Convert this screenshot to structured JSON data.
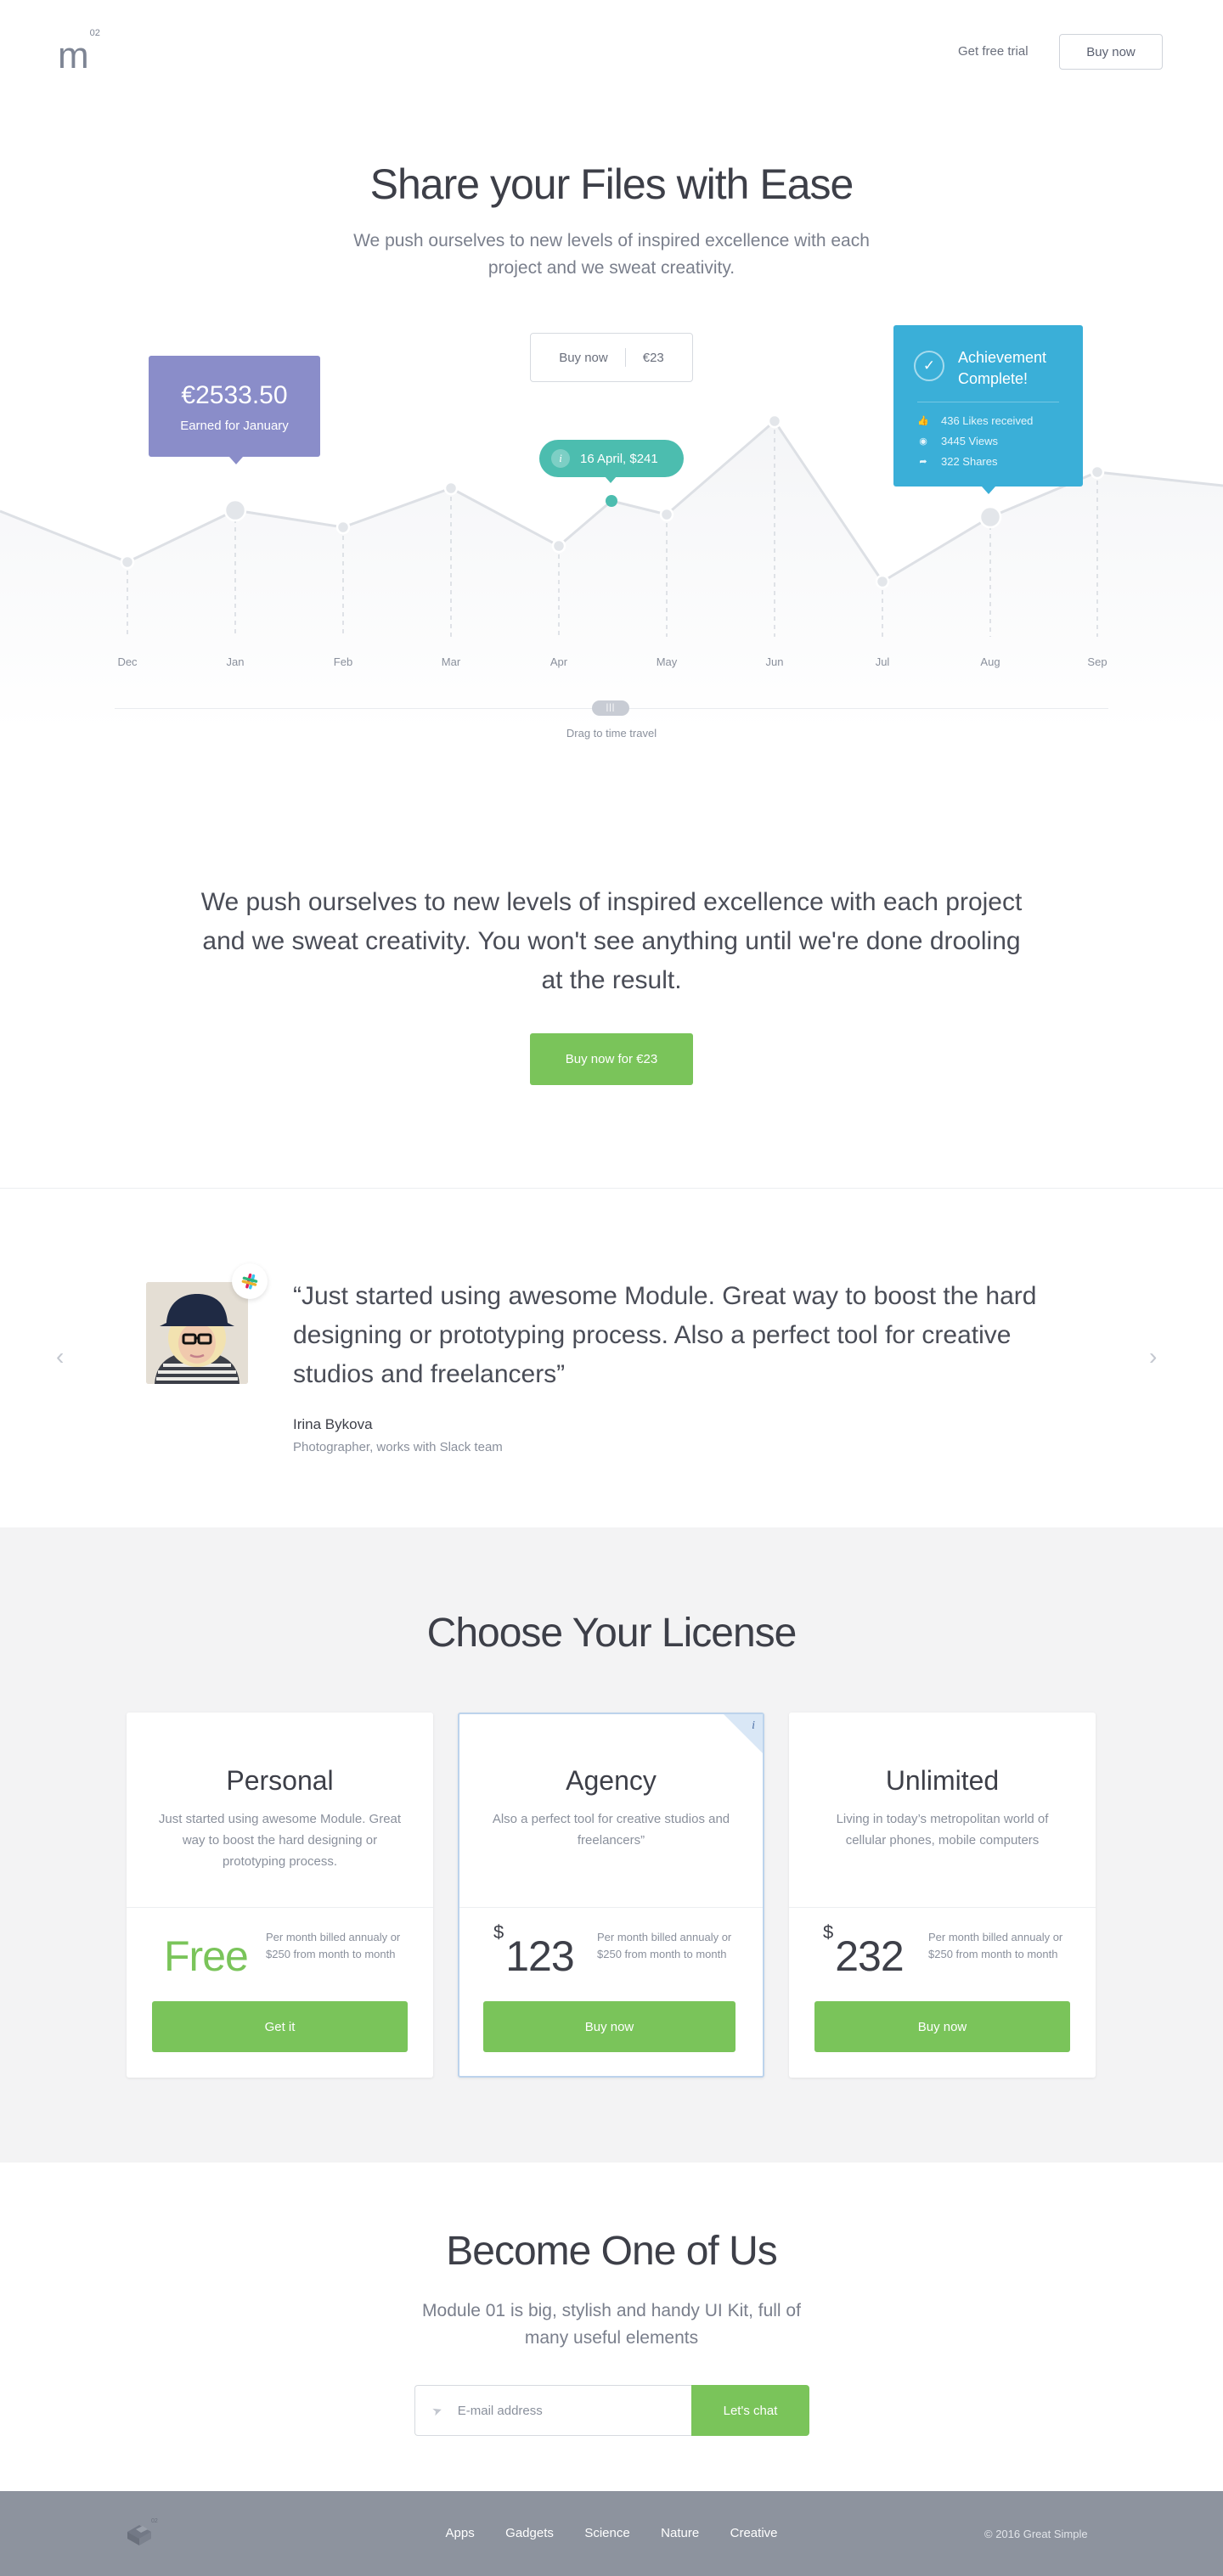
{
  "header": {
    "logo_text": "m",
    "logo_sup": "02",
    "trial_label": "Get free trial",
    "buy_label": "Buy now"
  },
  "hero": {
    "title": "Share your Files with Ease",
    "subtitle": "We push ourselves to new levels of inspired excellence with each project and we sweat creativity.",
    "buy_label": "Buy now",
    "buy_price": "€23"
  },
  "chart": {
    "months": [
      "Dec",
      "Jan",
      "Feb",
      "Mar",
      "Apr",
      "May",
      "Jun",
      "Jul",
      "Aug",
      "Sep"
    ],
    "earned_amount": "€2533.50",
    "earned_caption": "Earned for January",
    "date_tooltip": "16 April, $241",
    "date_icon": "i",
    "achievement_title": "Achievement Complete!",
    "stats": [
      {
        "icon": "thumbs-up-icon",
        "text": "436 Likes received"
      },
      {
        "icon": "eye-icon",
        "text": "3445 Views"
      },
      {
        "icon": "share-icon",
        "text": "322 Shares"
      }
    ],
    "timeline_handle": "|||",
    "timeline_caption": "Drag to time travel"
  },
  "statement": {
    "text": "We push ourselves to new levels of inspired excellence with each project and we sweat creativity. You won't see anything until we're done drooling at the result.",
    "cta": "Buy now for €23"
  },
  "testimonial": {
    "quote": "“Just started using awesome Module. Great way to boost the hard designing or prototyping process. Also a perfect tool for creative studios and freelancers”",
    "author": "Irina Bykova",
    "role": "Photographer, works with Slack team",
    "prev": "‹",
    "next": "›"
  },
  "pricing": {
    "title": "Choose Your License",
    "plans": [
      {
        "name": "Personal",
        "desc": "Just started using awesome Module. Great way to boost the hard designing or prototyping process.",
        "price": "Free",
        "currency": "",
        "billing": "Per month billed annualy or $250 from month to month",
        "cta": "Get it"
      },
      {
        "name": "Agency",
        "desc": "Also a perfect tool for creative studios and freelancers”",
        "price": "123",
        "currency": "$",
        "billing": "Per month billed annualy or $250 from month to month",
        "cta": "Buy now",
        "badge": "i"
      },
      {
        "name": "Unlimited",
        "desc": "Living in today’s metropolitan world of cellular phones, mobile computers",
        "price": "232",
        "currency": "$",
        "billing": "Per month billed annualy or $250 from month to month",
        "cta": "Buy now"
      }
    ]
  },
  "signup": {
    "title": "Become One of Us",
    "subtitle": "Module 01 is big, stylish and handy UI Kit, full of many useful elements",
    "email_placeholder": "E-mail address",
    "cta": "Let's chat"
  },
  "footer": {
    "nav": [
      "Apps",
      "Gadgets",
      "Science",
      "Nature",
      "Creative"
    ],
    "copyright": "© 2016 Great Simple"
  },
  "colors": {
    "accent_green": "#7ac45a",
    "card_purple": "#8a8dc9",
    "tooltip_teal": "#4cbdaf",
    "card_blue": "#3aafd8",
    "footer_bg": "#8d939e"
  }
}
